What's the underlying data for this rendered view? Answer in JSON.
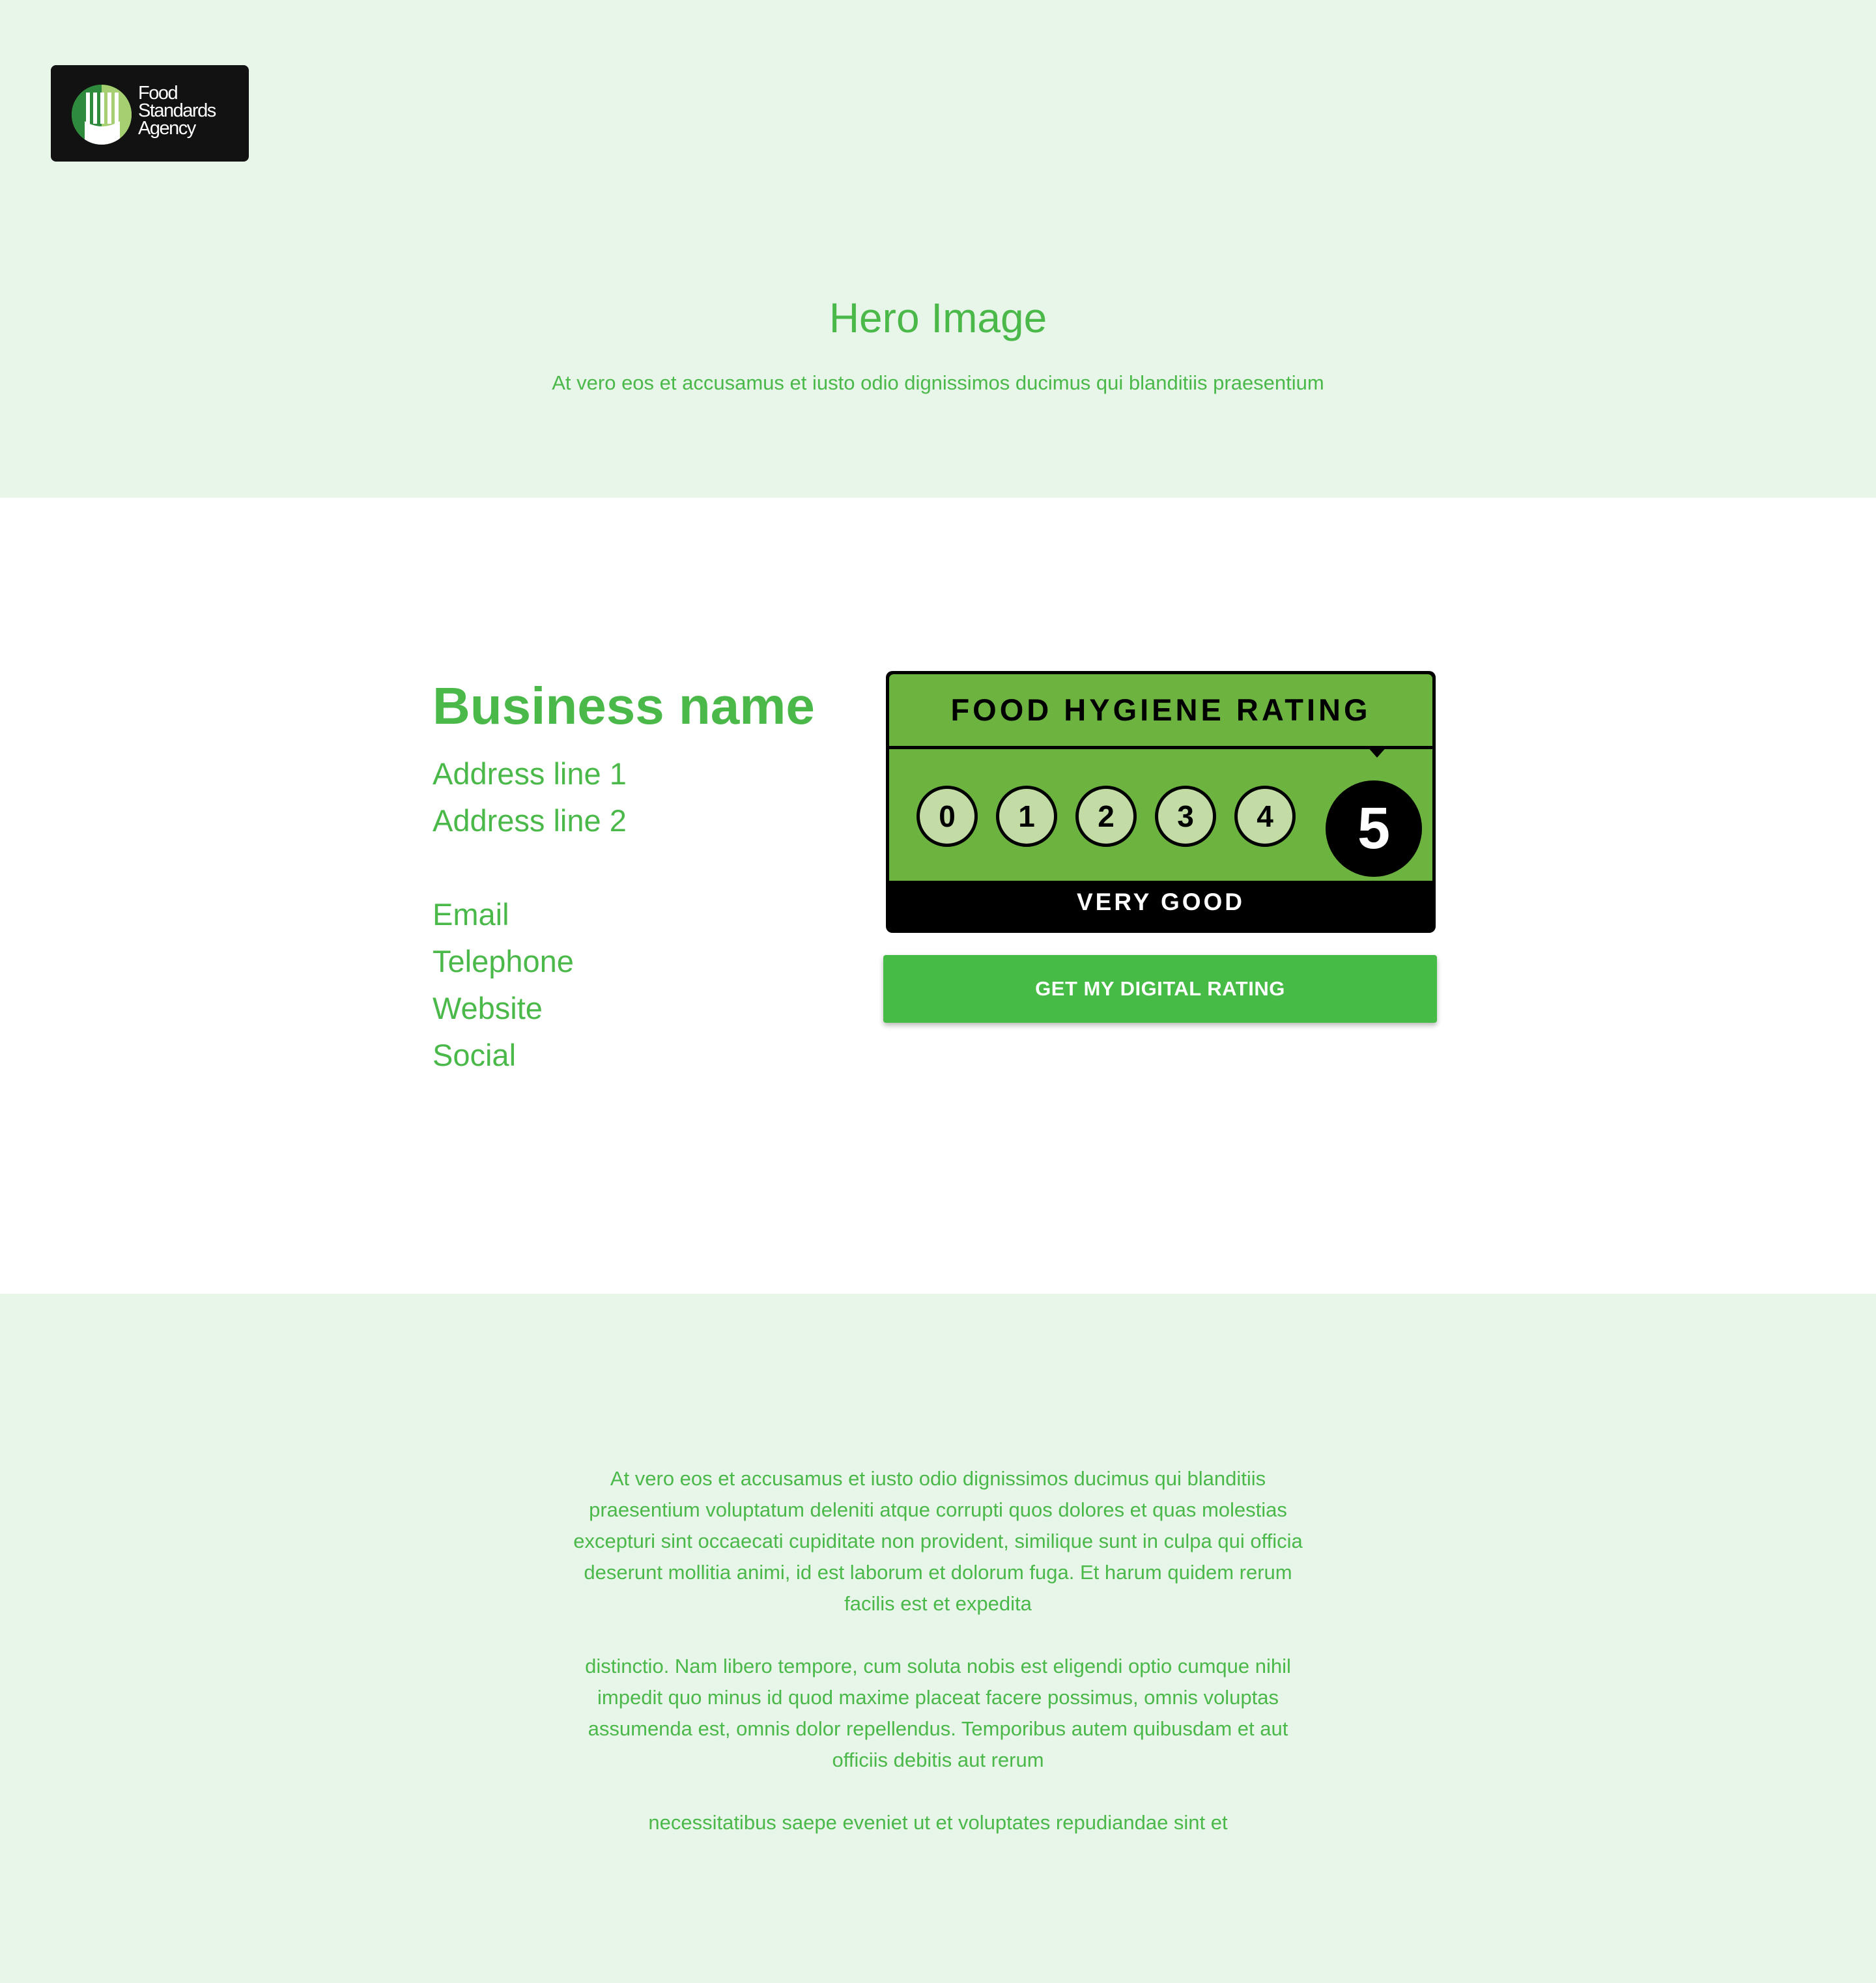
{
  "colors": {
    "accent_green": "#4ab94a",
    "hero_background": "#e8f5e9",
    "badge_green": "#6db33f",
    "badge_circle": "#c3dba5",
    "button_green": "#46bb46",
    "logo_background": "#121212"
  },
  "logo": {
    "line1": "Food",
    "line2": "Standards",
    "line3": "Agency"
  },
  "hero": {
    "title": "Hero Image",
    "subtitle": "At vero eos et accusamus et iusto odio dignissimos ducimus qui blanditiis praesentium"
  },
  "business": {
    "name": "Business name",
    "address_line_1": "Address line 1",
    "address_line_2": "Address line 2",
    "email": "Email",
    "telephone": "Telephone",
    "website": "Website",
    "social": "Social"
  },
  "rating_badge": {
    "title": "FOOD HYGIENE RATING",
    "scores": [
      "0",
      "1",
      "2",
      "3",
      "4"
    ],
    "selected_score": "5",
    "label": "VERY GOOD"
  },
  "cta": {
    "label": "GET MY DIGITAL RATING"
  },
  "footer": {
    "paragraph_1": "At vero eos et accusamus et iusto odio dignissimos ducimus qui blanditiis praesentium voluptatum deleniti atque corrupti quos dolores et quas molestias excepturi sint occaecati cupiditate non provident, similique sunt in culpa qui officia deserunt mollitia animi, id est laborum et dolorum fuga. Et harum quidem rerum facilis est et expedita",
    "paragraph_2": "distinctio. Nam libero tempore, cum soluta nobis est eligendi optio cumque nihil impedit quo minus id quod maxime placeat facere possimus, omnis voluptas assumenda est, omnis dolor repellendus. Temporibus autem quibusdam et aut officiis debitis aut rerum",
    "paragraph_3": "necessitatibus saepe eveniet ut et voluptates repudiandae sint et"
  }
}
